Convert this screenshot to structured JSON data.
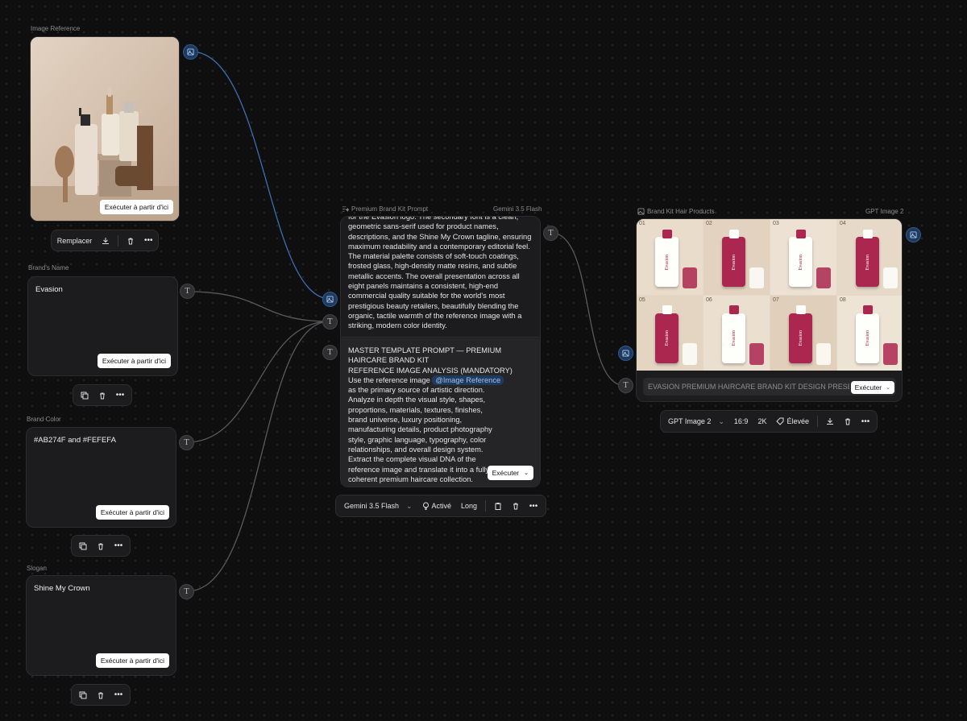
{
  "nodes": {
    "image_reference": {
      "label": "Image Reference",
      "run_label": "Exécuter à partir d'ici",
      "replace_label": "Remplacer"
    },
    "brand_name": {
      "label": "Brand's Name",
      "value": "Evasion",
      "run_label": "Exécuter à partir d'ici"
    },
    "brand_color": {
      "label": "Brand Color",
      "value": "#AB274F and  #FEFEFA",
      "run_label": "Exécuter à partir d'ici"
    },
    "slogan": {
      "label": "Slogan",
      "value": "Shine My Crown",
      "run_label": "Exécuter à partir d'ici"
    },
    "prompt": {
      "label": "Premium Brand Kit Prompt",
      "model": "Gemini 3.5 Flash",
      "scroll_text": "for the Evasion logo. The secondary font is a clean, geometric sans-serif used for product names, descriptions, and the Shine My Crown tagline, ensuring maximum readability and a contemporary editorial feel. The material palette consists of soft-touch coatings, frosted glass, high-density matte resins, and subtle metallic accents. The overall presentation across all eight panels maintains a consistent, high-end commercial quality suitable for the world's most prestigious beauty retailers, beautifully blending the organic, tactile warmth of the reference image with a striking, modern color identity.",
      "master_title_1": "MASTER TEMPLATE PROMPT — PREMIUM",
      "master_title_2": "HAIRCARE BRAND KIT",
      "master_title_3": "REFERENCE IMAGE ANALYSIS (MANDATORY)",
      "use_text": "Use the reference image",
      "mention": "@Image Reference",
      "body_text": "as the primary source of artistic direction. Analyze in depth the visual style, shapes, proportions, materials, textures, finishes, brand universe, luxury positioning, manufacturing details, product photography style, graphic language, typography, color relationships, and overall design system. Extract the complete visual DNA of the reference image and translate it into a fully coherent premium haircare collection.",
      "run_label": "Exécuter",
      "toolbar": {
        "model": "Gemini 3.5 Flash",
        "thinking": "Activé",
        "length": "Long"
      }
    },
    "output": {
      "label": "Brand Kit Hair Products",
      "model": "GPT Image 2",
      "panels": [
        "01",
        "02",
        "03",
        "04",
        "05",
        "06",
        "07",
        "08"
      ],
      "brand_on_products": "Evasion",
      "prompt_preview": "EVASION PREMIUM HAIRCARE BRAND KIT DESIGN PRESE...",
      "run_label": "Exécuter",
      "toolbar": {
        "model": "GPT Image 2",
        "ratio": "16:9",
        "resolution": "2K",
        "quality": "Élevée"
      }
    }
  },
  "colors": {
    "canvas": "#0f0f10",
    "card": "#1c1c1e",
    "wire_image": "#3b6fb0",
    "wire_text": "#5a5a5e",
    "brand_burgundy": "#AB274F",
    "brand_ivory": "#FEFEFA"
  }
}
